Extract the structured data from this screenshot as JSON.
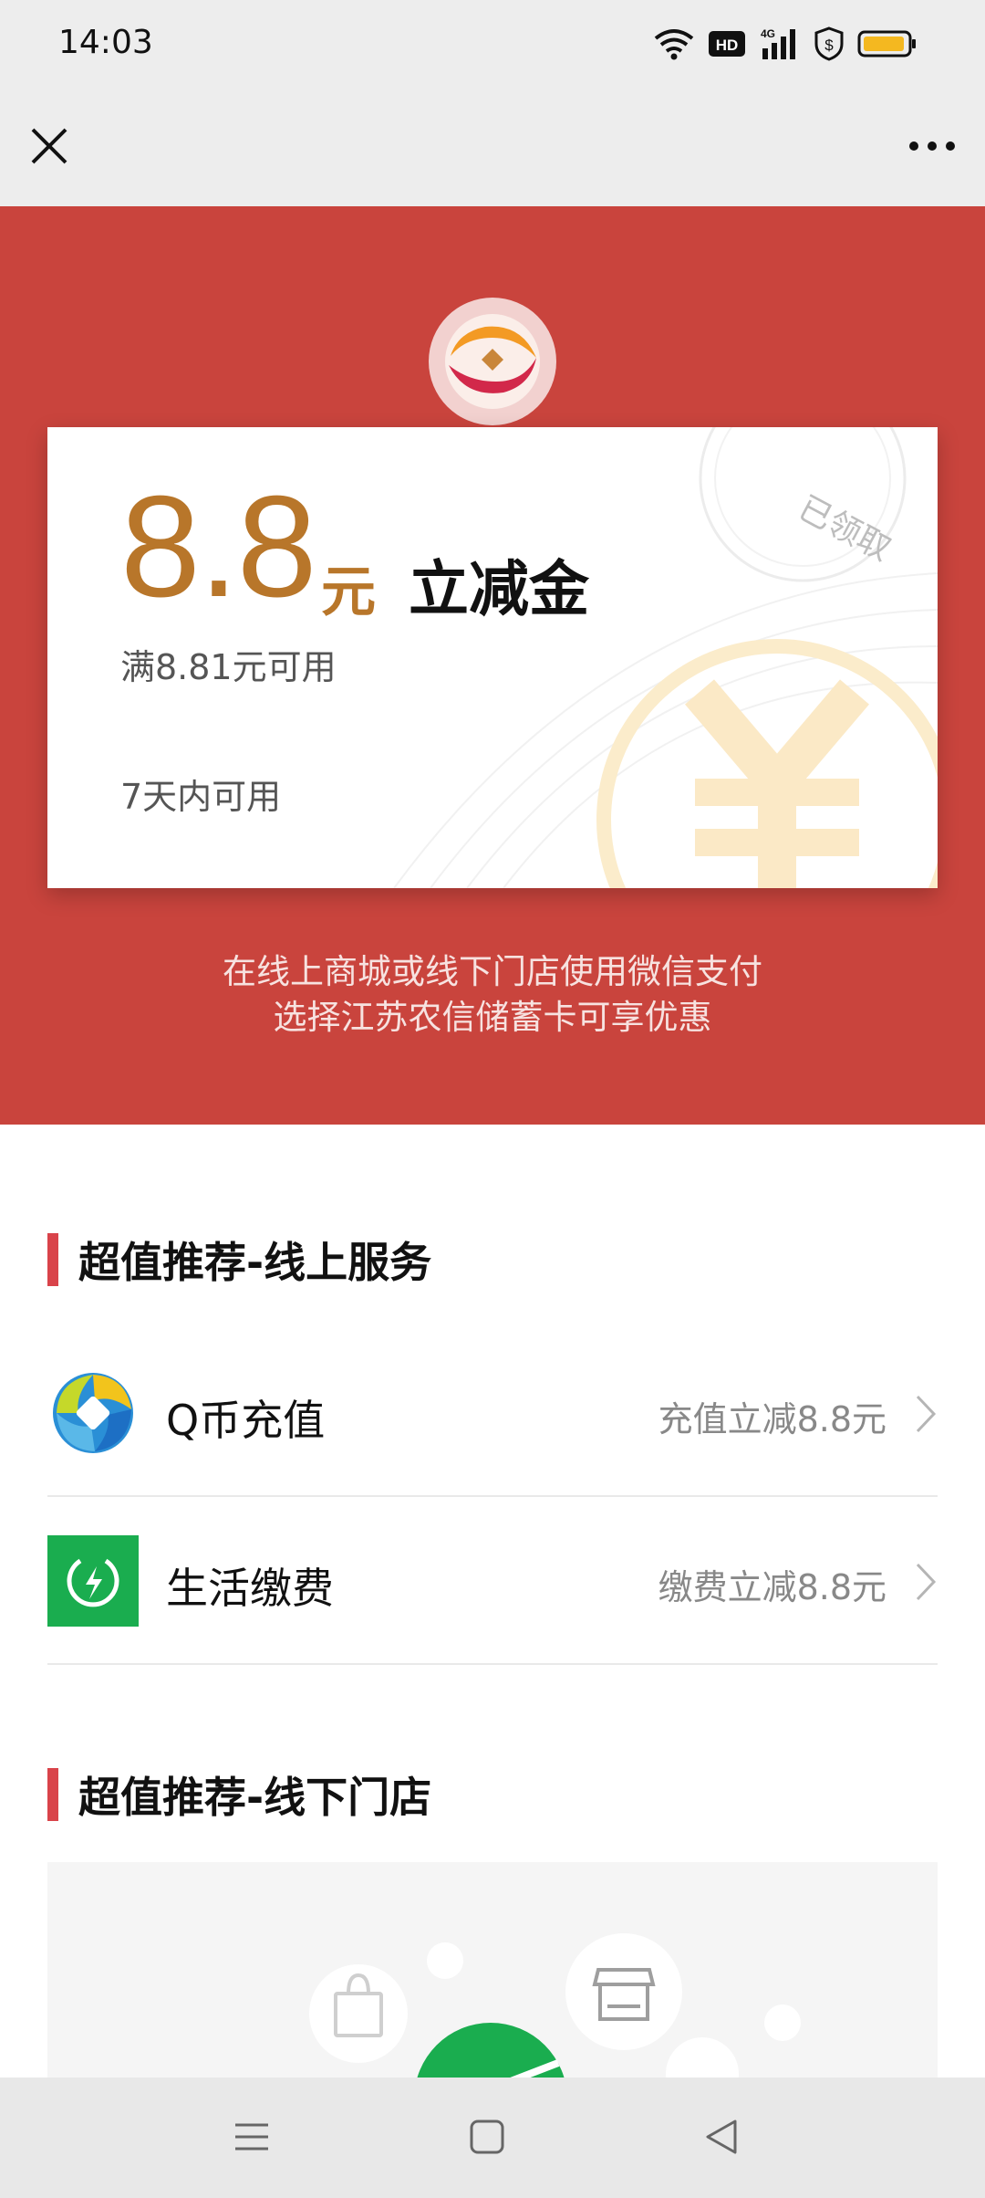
{
  "status_bar": {
    "time": "14:03",
    "icons": [
      "wifi-icon",
      "hd-icon",
      "4g-signal-icon",
      "shield-dollar-icon",
      "battery-icon"
    ],
    "hd_label": "HD",
    "net_label": "4G"
  },
  "header": {
    "close_icon": "close-icon",
    "more_icon": "more-icon"
  },
  "coupon": {
    "amount": "8.8",
    "unit": "元",
    "type": "立减金",
    "condition": "满8.81元可用",
    "validity": "7天内可用",
    "stamp": "已领取"
  },
  "banner": {
    "desc_line1": "在线上商城或线下门店使用微信支付",
    "desc_line2": "选择江苏农信储蓄卡可享优惠"
  },
  "online_section": {
    "title": "超值推荐-线上服务",
    "items": [
      {
        "name": "Q币充值",
        "promo": "充值立减8.8元",
        "icon": "qcoin-icon"
      },
      {
        "name": "生活缴费",
        "promo": "缴费立减8.8元",
        "icon": "utility-bill-icon"
      }
    ]
  },
  "offline_section": {
    "title": "超值推荐-线下门店"
  },
  "nav_bar": {
    "icons": [
      "menu-icon",
      "home-icon",
      "back-icon"
    ]
  },
  "colors": {
    "banner_red": "#c9443d",
    "gold": "#b8762a",
    "accent_bar": "#d9434a",
    "wechat_green": "#1aad4f"
  }
}
